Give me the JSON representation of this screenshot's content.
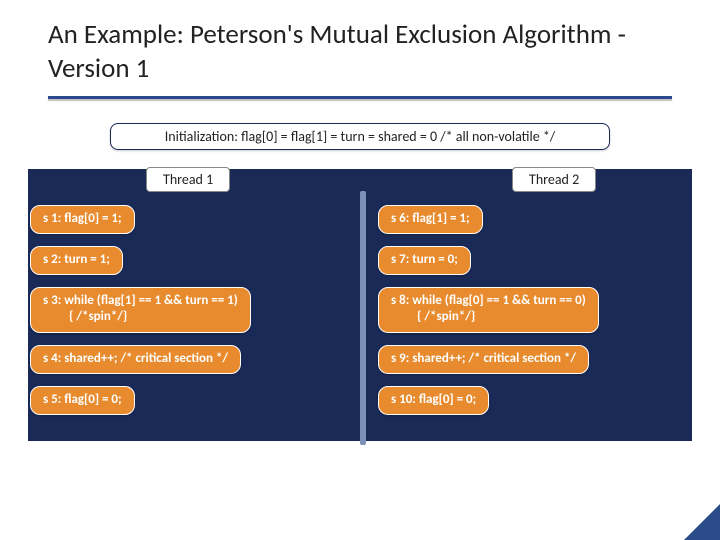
{
  "title": "An Example: Peterson's Mutual Exclusion Algorithm - Version 1",
  "init": "Initialization: flag[0] = flag[1] = turn = shared = 0 /* all non-volatile */",
  "thread1_label": "Thread 1",
  "thread2_label": "Thread 2",
  "thread1": {
    "s1": "s 1: flag[0] = 1;",
    "s2": "s 2: turn = 1;",
    "s3_a": "s 3: while (flag[1] == 1 && turn == 1)",
    "s3_b": "{ /*spin*/}",
    "s4": "s 4: shared++; /* critical section */",
    "s5": "s 5: flag[0] = 0;"
  },
  "thread2": {
    "s6": "s 6: flag[1] = 1;",
    "s7": "s 7: turn = 0;",
    "s8_a": "s 8: while (flag[0] == 1 && turn == 0)",
    "s8_b": "{ /*spin*/}",
    "s9": "s 9: shared++; /* critical section */",
    "s10": "s 10: flag[0] = 0;"
  }
}
